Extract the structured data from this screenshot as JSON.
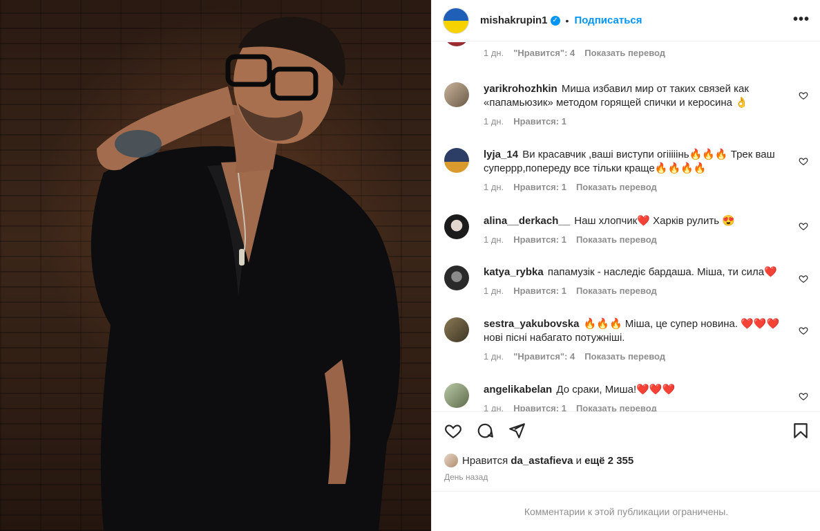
{
  "post": {
    "author": "mishakrupin1",
    "dot": "•",
    "follow_label": "Подписаться",
    "more_label": "•••",
    "verified_mark": "✓"
  },
  "comments": [
    {
      "user": "",
      "text": "",
      "time": "1 дн.",
      "likes": "\"Нравится\": 4",
      "translate": "Показать перевод"
    },
    {
      "user": "yarikrohozhkin",
      "text": "Миша избавил мир от таких связей как «папамьюзик» методом горящей спички и керосина 👌",
      "time": "1 дн.",
      "likes": "Нравится: 1",
      "translate": ""
    },
    {
      "user": "lyja_14",
      "text": "Ви красавчик ,ваші виступи огііііінь🔥🔥🔥 Трек ваш суперрр,попереду все тільки краще🔥🔥🔥🔥",
      "time": "1 дн.",
      "likes": "Нравится: 1",
      "translate": "Показать перевод"
    },
    {
      "user": "alina__derkach__",
      "text": "Наш хлопчик❤️ Харків рулить 😍",
      "time": "1 дн.",
      "likes": "Нравится: 1",
      "translate": "Показать перевод"
    },
    {
      "user": "katya_rybka",
      "text": "папамузік - наследіє бардаша. Міша, ти сила❤️",
      "time": "1 дн.",
      "likes": "Нравится: 1",
      "translate": "Показать перевод"
    },
    {
      "user": "sestra_yakubovska",
      "text": "🔥🔥🔥 Міша, це супер новина. ❤️❤️❤️ нові пісні набагато потужніші.",
      "time": "1 дн.",
      "likes": "\"Нравится\": 4",
      "translate": "Показать перевод"
    },
    {
      "user": "angelikabelan",
      "text": "До сраки, Миша!❤️❤️❤️",
      "time": "1 дн.",
      "likes": "Нравится: 1",
      "translate": "Показать перевод"
    }
  ],
  "likes_summary": {
    "prefix": "Нравится",
    "user": "da_astafieva",
    "and_word": "и",
    "others": "ещё 2 355"
  },
  "date": "День назад",
  "restricted_notice": "Комментарии к этой публикации ограничены."
}
